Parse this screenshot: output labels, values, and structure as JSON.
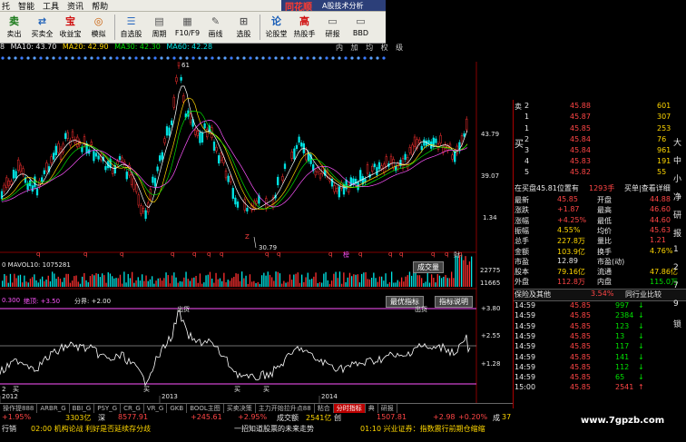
{
  "menubar": {
    "items": [
      "托",
      "智能",
      "工具",
      "资讯",
      "帮助"
    ],
    "brand": "同花顺",
    "brand_sub": "A股技术分析"
  },
  "toolbar": {
    "buttons": [
      {
        "label": "卖出",
        "icon": "卖",
        "color": "#1a7a1a"
      },
      {
        "label": "买卖全",
        "icon": "⇄",
        "color": "#1b5fb8"
      },
      {
        "label": "收益宝",
        "icon": "宝",
        "color": "#d01010"
      },
      {
        "label": "模拟",
        "icon": "◎",
        "color": "#c85a00"
      },
      {
        "label": "自选股",
        "icon": "☰",
        "color": "#2a6ac0"
      },
      {
        "label": "周期",
        "icon": "▤",
        "color": "#555"
      },
      {
        "label": "F10/F9",
        "icon": "▦",
        "color": "#555"
      },
      {
        "label": "画线",
        "icon": "✎",
        "color": "#555"
      },
      {
        "label": "选股",
        "icon": "⊞",
        "color": "#555"
      },
      {
        "label": "论股堂",
        "icon": "论",
        "color": "#1b5fb8"
      },
      {
        "label": "热股手",
        "icon": "高",
        "color": "#d01010"
      },
      {
        "label": "研报",
        "icon": "▭",
        "color": "#555"
      },
      {
        "label": "BBD",
        "icon": "▭",
        "color": "#555"
      }
    ]
  },
  "ma_header": {
    "ma5": "8",
    "ma10": "MA10: 43.70",
    "ma20": "MA20: 42.90",
    "ma30": "MA30: 42.30",
    "ma60": "MA60: 42.28",
    "icons": "内 加 均 权 级"
  },
  "chart_labels": {
    "top_marker": "61",
    "y_labels": [
      "43.79",
      "39.07",
      "1.34"
    ],
    "low_marker": "30.79",
    "vol_header": "0  MAVOL10: 1075281",
    "vol_y": [
      "22775",
      "11665"
    ],
    "vol_pill": "成交量",
    "ind_header_a": "0.300",
    "ind_header_b": "绝顶: +3.50",
    "ind_header_c": "分界: +2.00",
    "ind_pill_a": "最优指标",
    "ind_pill_b": "指标说明",
    "ind_y": [
      "+3.80",
      "+2.55",
      "+1.28"
    ],
    "bottom_y": "2",
    "top_tag": "出货",
    "top_tag2": "出货",
    "bottom_tags": [
      "买",
      "买",
      "买",
      "买"
    ],
    "years": [
      "2012",
      "2013",
      "2014"
    ],
    "marks": [
      "q",
      "q",
      "q",
      "q",
      "q",
      "q",
      "q",
      "q",
      "q",
      "q",
      "q",
      "q",
      "q",
      "q",
      "q",
      "q",
      "Z",
      "榜",
      "財"
    ]
  },
  "tabs": [
    "操作提888",
    "ARBR_G",
    "BBI_G",
    "PSY_G",
    "CR_G",
    "VR_G",
    "GKB",
    "BOOL主图",
    "买卖决策",
    "主力开始拉升点88",
    "粘合",
    "分时指标",
    "典",
    "研报"
  ],
  "status1": {
    "a": "+1.95%",
    "b": "3303亿",
    "c": "深",
    "d": "8577.91",
    "e": "+245.61",
    "f": "+2.95%",
    "g": "成交额",
    "h": "2541亿",
    "i": "创",
    "j": "1507.81",
    "k": "+2.98",
    "l": "+0.20%",
    "m": "成",
    "n": "37"
  },
  "status2": {
    "a": "行销",
    "b": "02:00 机构论战 利好是否延续存分歧",
    "c": "一招知道股票的未来走势",
    "d": "01:10 兴业证券：指数震行前期仓缩缩",
    "e": "行情"
  },
  "order_book": {
    "sell_label": "卖",
    "sell": [
      {
        "lv": "2",
        "price": "45.88",
        "vol": "601",
        "color": "red"
      },
      {
        "lv": "1",
        "price": "45.87",
        "vol": "307",
        "color": "red"
      }
    ],
    "buy_label": "买",
    "buy": [
      {
        "lv": "1",
        "price": "45.85",
        "vol": "253",
        "color": "red"
      },
      {
        "lv": "2",
        "price": "45.84",
        "vol": "76",
        "color": "red"
      },
      {
        "lv": "3",
        "price": "45.84",
        "vol": "961",
        "color": "red"
      },
      {
        "lv": "4",
        "price": "45.83",
        "vol": "191",
        "color": "red"
      },
      {
        "lv": "5",
        "price": "45.82",
        "vol": "55",
        "color": "red"
      }
    ],
    "info_line": "在买盘45.81位置有",
    "info_vol": "1293手",
    "info_link": "买单|查看详细"
  },
  "quote": [
    {
      "k1": "最新",
      "v1": "45.85",
      "c1": "red",
      "k2": "开盘",
      "v2": "44.88",
      "c2": "red"
    },
    {
      "k1": "涨跌",
      "v1": "+1.87",
      "c1": "red",
      "k2": "最高",
      "v2": "46.60",
      "c2": "red"
    },
    {
      "k1": "涨幅",
      "v1": "+4.25%",
      "c1": "red",
      "k2": "最低",
      "v2": "44.60",
      "c2": "red"
    },
    {
      "k1": "振幅",
      "v1": "4.55%",
      "c1": "yel",
      "k2": "均价",
      "v2": "45.63",
      "c2": "red"
    },
    {
      "k1": "总手",
      "v1": "227.8万",
      "c1": "yel",
      "k2": "量比",
      "v2": "1.21",
      "c2": "red"
    },
    {
      "k1": "金额",
      "v1": "103.9亿",
      "c1": "yel",
      "k2": "换手",
      "v2": "4.76%",
      "c2": "yel"
    },
    {
      "k1": "市盈",
      "v1": "12.89",
      "c1": "wht",
      "k2": "市盈(动)",
      "v2": "",
      "c2": "wht"
    },
    {
      "k1": "股本",
      "v1": "79.16亿",
      "c1": "yel",
      "k2": "流通",
      "v2": "47.86亿",
      "c2": "yel"
    },
    {
      "k1": "外盘",
      "v1": "112.8万",
      "c1": "red",
      "k2": "内盘",
      "v2": "115.0万",
      "c2": "grn"
    }
  ],
  "quote_tabs": {
    "left": "保险及其他",
    "pct": "3.54%",
    "right": "同行业比较"
  },
  "trades": [
    {
      "t": "14:59",
      "p": "45.85",
      "v": "997",
      "d": "down"
    },
    {
      "t": "14:59",
      "p": "45.85",
      "v": "2384",
      "d": "down"
    },
    {
      "t": "14:59",
      "p": "45.85",
      "v": "123",
      "d": "down"
    },
    {
      "t": "14:59",
      "p": "45.85",
      "v": "13",
      "d": "down"
    },
    {
      "t": "14:59",
      "p": "45.85",
      "v": "117",
      "d": "down"
    },
    {
      "t": "14:59",
      "p": "45.85",
      "v": "141",
      "d": "down"
    },
    {
      "t": "14:59",
      "p": "45.85",
      "v": "112",
      "d": "down"
    },
    {
      "t": "14:59",
      "p": "45.85",
      "v": "65",
      "d": "down"
    },
    {
      "t": "15:00",
      "p": "45.85",
      "v": "2541",
      "d": "up"
    }
  ],
  "right_side_chars": [
    "大",
    "中",
    "小",
    "净",
    "研",
    "报",
    "1",
    "2",
    "7",
    "9",
    "锁"
  ],
  "watermark": "www.7gpzb.com",
  "colors": {
    "up": "#ff4545",
    "down": "#00e000",
    "accent": "#ffd700",
    "panel_border": "#aa0000"
  }
}
